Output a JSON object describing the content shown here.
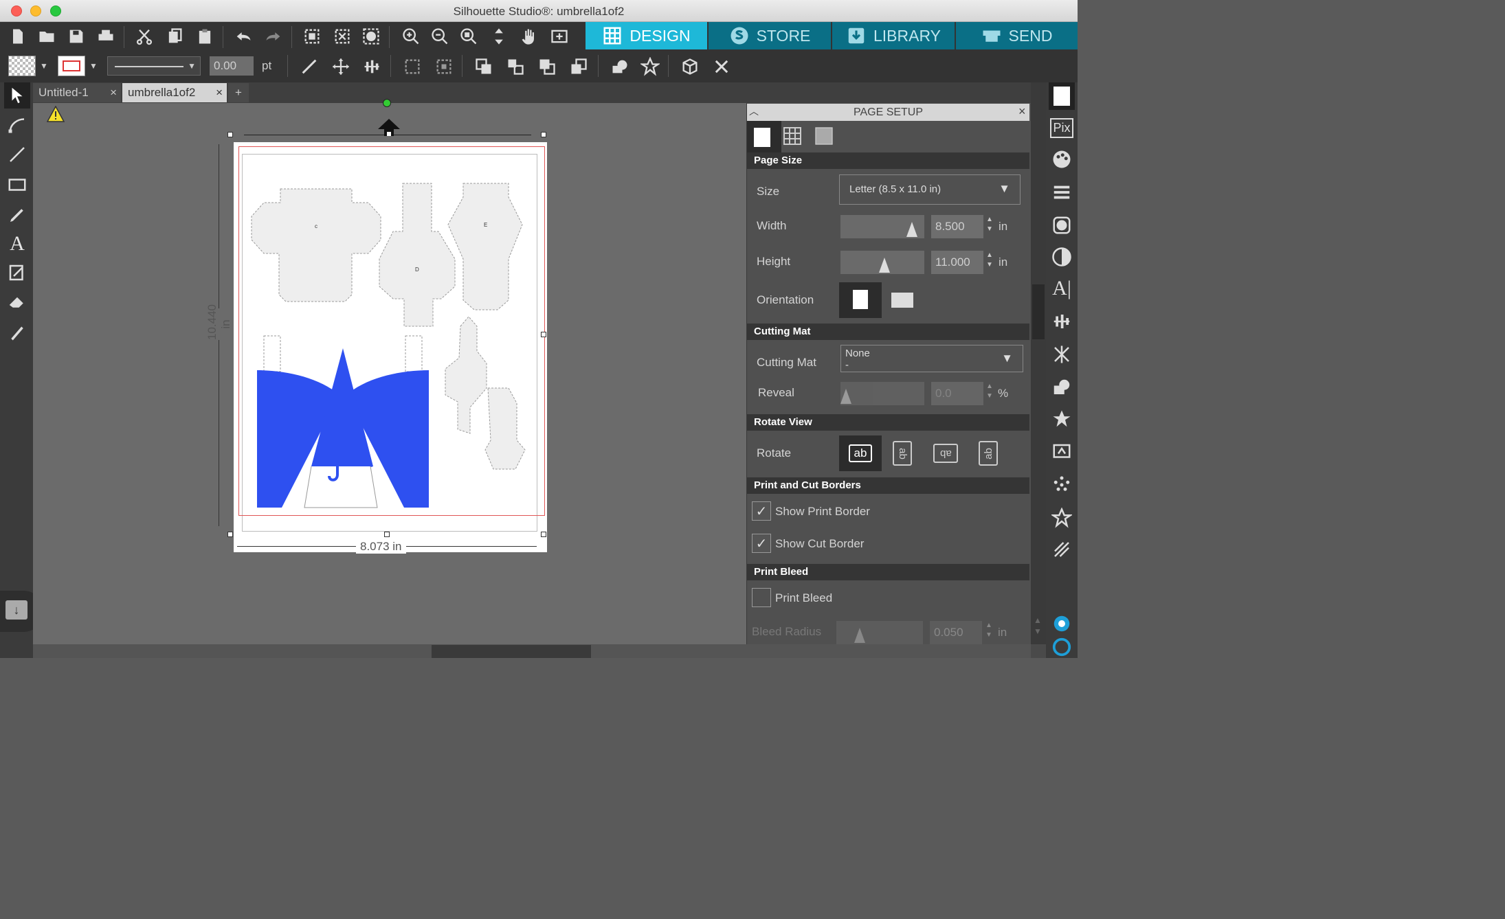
{
  "window": {
    "title": "Silhouette Studio®: umbrella1of2"
  },
  "nav": {
    "design": "DESIGN",
    "store": "STORE",
    "library": "LIBRARY",
    "send": "SEND"
  },
  "toolbar2": {
    "line_width_value": "0.00",
    "line_width_unit": "pt"
  },
  "tabs": [
    {
      "label": "Untitled-1",
      "close": "×"
    },
    {
      "label": "umbrella1of2",
      "close": "×"
    },
    {
      "label": "+"
    }
  ],
  "canvas": {
    "width_dim": "8.073 in",
    "height_dim": "10.440 in"
  },
  "panel": {
    "title": "PAGE SETUP",
    "close": "×",
    "page_size": {
      "header": "Page Size",
      "size_label": "Size",
      "size_value": "Letter (8.5 x 11.0 in)",
      "width_label": "Width",
      "width_value": "8.500",
      "height_label": "Height",
      "height_value": "11.000",
      "unit": "in",
      "orientation_label": "Orientation"
    },
    "cutting_mat": {
      "header": "Cutting Mat",
      "label": "Cutting Mat",
      "value": "None",
      "value_sub": "-",
      "reveal_label": "Reveal",
      "reveal_value": "0.0",
      "reveal_unit": "%"
    },
    "rotate_view": {
      "header": "Rotate View",
      "label": "Rotate",
      "options": [
        "ab",
        "ab",
        "ab",
        "ab"
      ]
    },
    "borders": {
      "header": "Print and Cut Borders",
      "show_print": "Show Print Border",
      "show_print_checked": true,
      "show_cut": "Show Cut Border",
      "show_cut_checked": true
    },
    "bleed": {
      "header": "Print Bleed",
      "print_bleed": "Print Bleed",
      "print_bleed_checked": false,
      "radius_label": "Bleed Radius",
      "radius_value": "0.050",
      "radius_unit": "in"
    }
  },
  "colors": {
    "accent": "#1e9fb8",
    "nav_bg": "#0a6f86",
    "blue_shape": "#2e50f0",
    "cut_border": "#e05555"
  }
}
